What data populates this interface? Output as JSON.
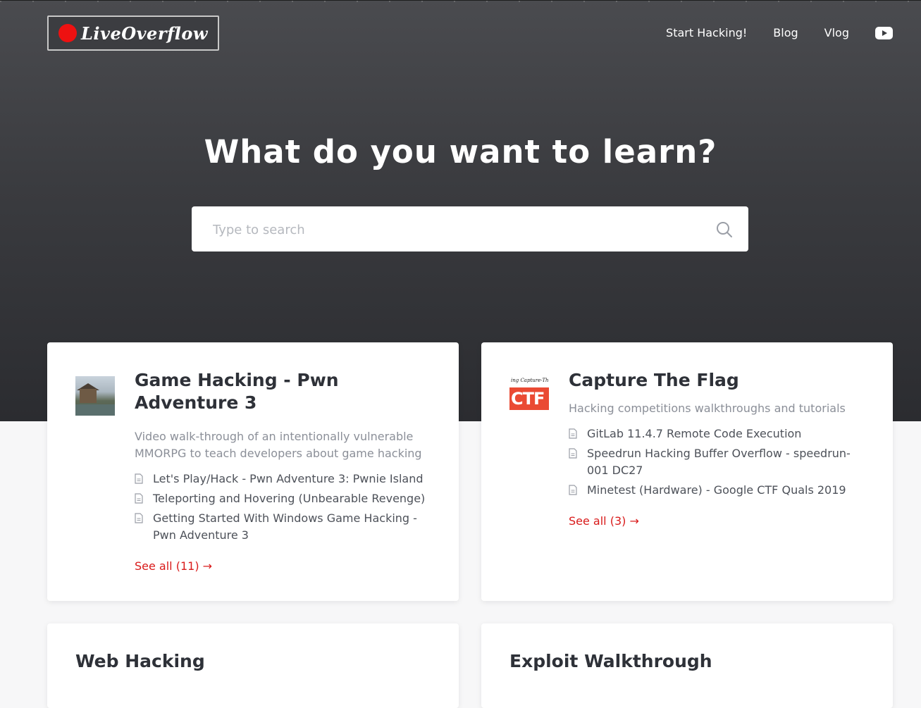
{
  "header": {
    "logo_text": "LiveOverflow",
    "nav": [
      {
        "label": "Start Hacking!"
      },
      {
        "label": "Blog"
      },
      {
        "label": "Vlog"
      }
    ],
    "youtube_icon": "youtube-icon"
  },
  "hero": {
    "title": "What do you want to learn?",
    "search_placeholder": "Type to search",
    "search_icon": "search-icon"
  },
  "collections": [
    {
      "title": "Game Hacking - Pwn Adventure 3",
      "description": "Video walk-through of an intentionally vulnerable MMORPG to teach developers about game hacking",
      "articles": [
        "Let's Play/Hack - Pwn Adventure 3: Pwnie Island",
        "Teleporting and Hovering (Unbearable Revenge)",
        "Getting Started With Windows Game Hacking - Pwn Adventure 3"
      ],
      "see_all": "See all (11) →"
    },
    {
      "title": "Capture The Flag",
      "thumb_caption": "ing Capture-The-F",
      "thumb_big": "CTF",
      "description": "Hacking competitions walkthroughs and tutorials",
      "articles": [
        "GitLab 11.4.7 Remote Code Execution",
        "Speedrun Hacking Buffer Overflow - speedrun-001 DC27",
        "Minetest (Hardware) - Google CTF Quals 2019"
      ],
      "see_all": "See all (3) →"
    },
    {
      "title": "Web Hacking"
    },
    {
      "title": "Exploit Walkthrough"
    }
  ],
  "colors": {
    "accent": "#d91a1a",
    "logo_dot": "#ee1111",
    "hero_bg": "#3a3b3f"
  }
}
